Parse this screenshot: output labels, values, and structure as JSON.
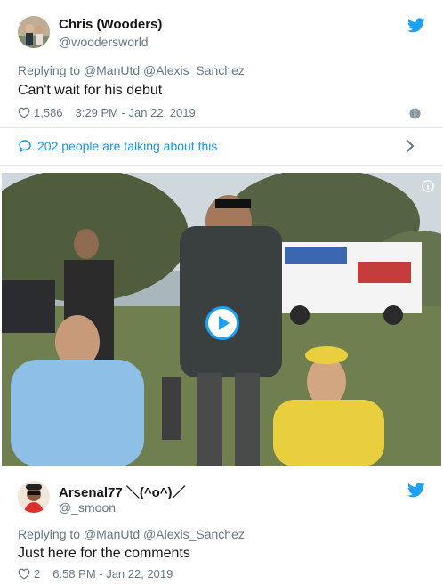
{
  "tweets": [
    {
      "name": "Chris (Wooders)",
      "handle": "@woodersworld",
      "replying": "Replying to @ManUtd @Alexis_Sanchez",
      "text": "Can't wait for his debut",
      "likes": "1,586",
      "timestamp": "3:29 PM - Jan 22, 2019",
      "talking": "202 people are talking about this"
    },
    {
      "name": "Arsenal77 ＼(^o^)／",
      "handle": "@_smoon",
      "replying": "Replying to @ManUtd @Alexis_Sanchez",
      "text": "Just here for the comments",
      "likes": "2",
      "timestamp": "6:58 PM - Jan 22, 2019"
    }
  ],
  "icons": {
    "brand": "twitter-bird-icon",
    "like": "heart-icon",
    "info": "info-icon",
    "comment": "speech-bubble-icon",
    "chevron": "chevron-right-icon",
    "play": "play-icon"
  },
  "colors": {
    "accent": "#1da1f2",
    "link": "#1b95e0",
    "muted": "#657786",
    "text": "#14171a"
  }
}
